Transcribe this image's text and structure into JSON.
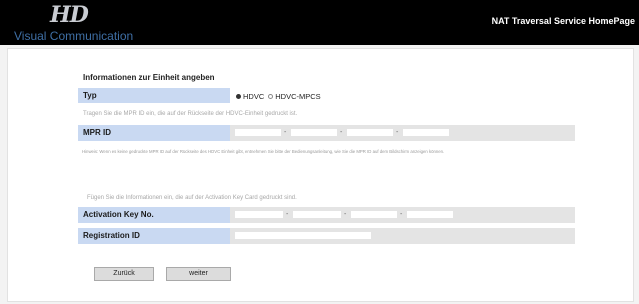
{
  "header": {
    "logo_mark": "HD",
    "logo_subtitle": "Visual Communication",
    "home_link": "NAT Traversal Service HomePage"
  },
  "form": {
    "section_title": "Informationen zur Einheit angeben",
    "type": {
      "label": "Typ",
      "options": [
        "HDVC",
        "HDVC-MPCS"
      ],
      "selected": "HDVC"
    },
    "mpr_hint": "Tragen Sie die MPR ID ein, die auf der Rückseite der HDVC-Einheit gedruckt ist.",
    "mpr_label": "MPR ID",
    "mpr_note": "Hinweis: Wenn es keine gedruckte MPR ID auf der Rückseite des HDVC Einheit gibt, entnehmen Sie bitte der Bedienungsanleitung, wie Sie die MPR ID auf dem Bildschirm anzeigen können.",
    "activation_hint": "Fügen Sie die Informationen ein, die auf der Activation Key Card gedruckt sind.",
    "activation_label": "Activation Key No.",
    "registration_label": "Registration ID",
    "separator": "-"
  },
  "buttons": {
    "back": "Zurück",
    "next": "weiter"
  }
}
